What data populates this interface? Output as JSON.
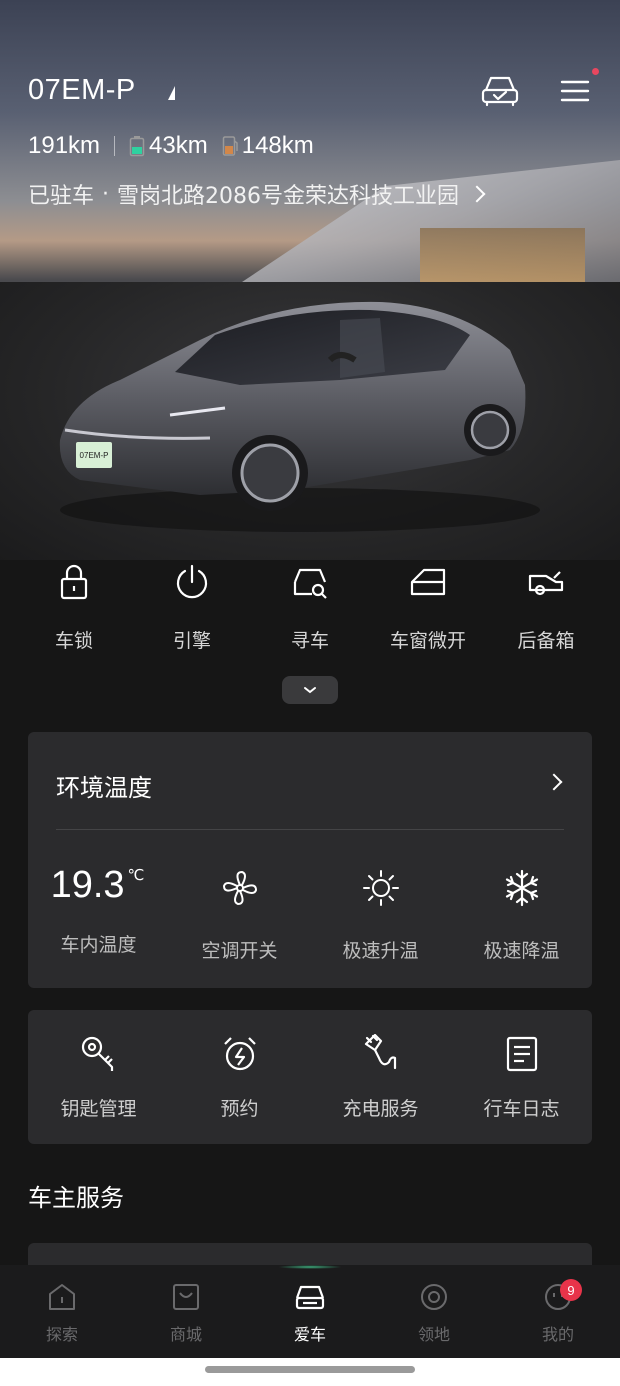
{
  "header": {
    "vehicle_name": "07EM-P",
    "range_total": "191km",
    "range_electric": "43km",
    "range_fuel": "148km",
    "status": "已驻车",
    "separator": "·",
    "location": "雪岗北路2086号金荣达科技工业园"
  },
  "icons": {
    "car_check": "car-check-icon",
    "menu": "menu-icon",
    "battery": "battery-icon",
    "fuel": "fuel-icon"
  },
  "colors": {
    "accent_green": "#46d296",
    "badge_red": "#e8344a",
    "battery_fill": "#2fd1a0",
    "fuel_fill": "#d2874a"
  },
  "quick_controls": [
    {
      "label": "车锁",
      "icon": "lock-icon"
    },
    {
      "label": "引擎",
      "icon": "power-icon"
    },
    {
      "label": "寻车",
      "icon": "find-car-icon"
    },
    {
      "label": "车窗微开",
      "icon": "window-icon"
    },
    {
      "label": "后备箱",
      "icon": "trunk-icon"
    }
  ],
  "environment": {
    "title": "环境温度",
    "inside_temp": "19.3",
    "temp_unit": "℃",
    "items": [
      {
        "label": "车内温度"
      },
      {
        "label": "空调开关",
        "icon": "fan-icon"
      },
      {
        "label": "极速升温",
        "icon": "sun-icon"
      },
      {
        "label": "极速降温",
        "icon": "snowflake-icon"
      }
    ]
  },
  "services": [
    {
      "label": "钥匙管理",
      "icon": "key-icon"
    },
    {
      "label": "预约",
      "icon": "alarm-clock-icon"
    },
    {
      "label": "充电服务",
      "icon": "charging-plug-icon"
    },
    {
      "label": "行车日志",
      "icon": "log-icon"
    }
  ],
  "owner_services_title": "车主服务",
  "tabs": [
    {
      "label": "探索",
      "icon": "explore-icon",
      "active": false
    },
    {
      "label": "商城",
      "icon": "shop-icon",
      "active": false
    },
    {
      "label": "爱车",
      "icon": "car-icon",
      "active": true
    },
    {
      "label": "领地",
      "icon": "territory-icon",
      "active": false
    },
    {
      "label": "我的",
      "icon": "profile-icon",
      "active": false,
      "badge": "9"
    }
  ]
}
